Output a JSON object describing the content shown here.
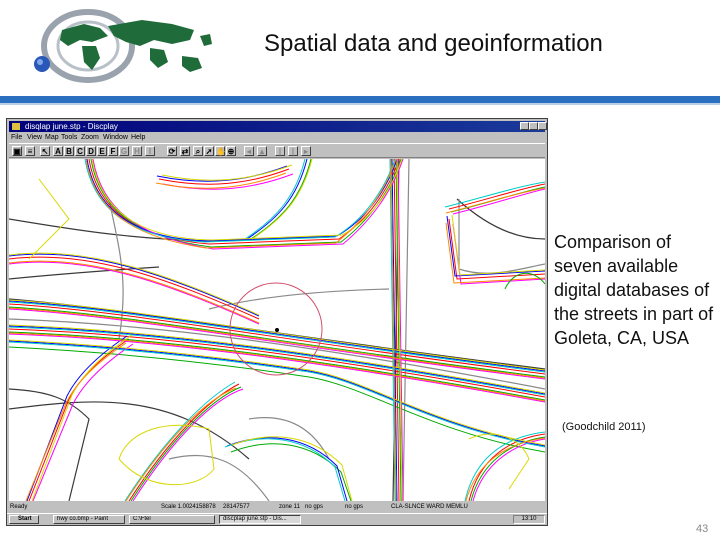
{
  "slide": {
    "title": "Spatial data and geoinformation",
    "caption": "Comparison of seven available digital databases of the streets in part of Goleta, CA, USA",
    "citation": "(Goodchild 2011)",
    "page_number": "43",
    "accent_color": "#2a6fc0"
  },
  "window": {
    "title": "disqlap june.stp - Discplay",
    "menu": [
      "File",
      "View",
      "Map",
      "Tools",
      "Zoom",
      "Window",
      "Help"
    ],
    "toolbar_letters": [
      "A",
      "B",
      "C",
      "D",
      "E",
      "F",
      "G",
      "H",
      "I"
    ],
    "status": {
      "ready": "Ready",
      "scale": "Scale 1.00",
      "x": "24158878",
      "y": "28147577",
      "zone": "zone 11",
      "gps1": "no gps",
      "gps2": "no gps",
      "extra": "CLA-SLNCE WARD MEMLU"
    }
  },
  "taskbar": {
    "start": "Start",
    "tasks": [
      "hwy co.bmp - Paint",
      "C:\\Ftel",
      "discplap june.stp - Dis..."
    ],
    "clock": "13:10"
  },
  "map": {
    "street_colors": [
      "#ff0000",
      "#00aa00",
      "#0000ff",
      "#ff00ff",
      "#00cccc",
      "#d8d800",
      "#ff8800",
      "#8a8a8a",
      "#3a3a3a"
    ]
  }
}
